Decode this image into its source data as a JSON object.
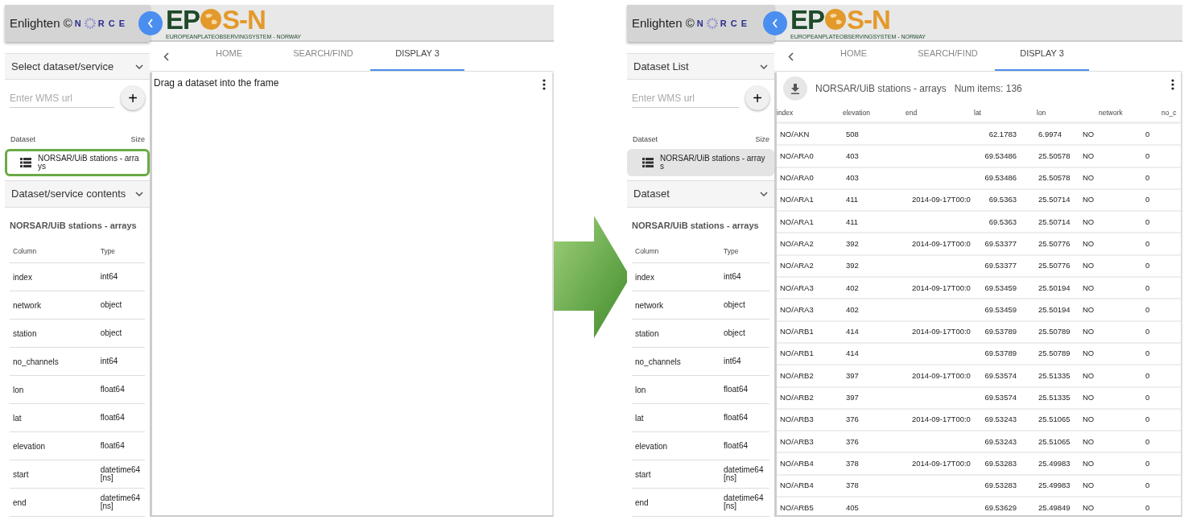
{
  "screens": [
    {
      "app_name": "Enlighten ©",
      "brand_letters": [
        "N",
        "R C E"
      ],
      "logo": {
        "main": [
          "EP",
          "S-N"
        ],
        "subtitle": "EUROPEANPLATEOBSERVINGSYSTEM - NORWAY"
      },
      "source_accordion": {
        "label": "Select dataset/service"
      },
      "url_field": {
        "placeholder": "Enter WMS url",
        "add_label": "+"
      },
      "dataset_list": {
        "columns": [
          "Dataset",
          "Size"
        ],
        "items": [
          {
            "name": "NORSAR/UiB stations - arrays",
            "selected": false,
            "highlighted": true
          }
        ]
      },
      "contents_accordion": {
        "label": "Dataset/service contents"
      },
      "contents_title": "NORSAR/UiB stations - arrays",
      "schema": {
        "columns": [
          "Column",
          "Type"
        ],
        "rows": [
          [
            "index",
            "int64"
          ],
          [
            "network",
            "object"
          ],
          [
            "station",
            "object"
          ],
          [
            "no_channels",
            "int64"
          ],
          [
            "lon",
            "float64"
          ],
          [
            "lat",
            "float64"
          ],
          [
            "elevation",
            "float64"
          ],
          [
            "start",
            "datetime64[ns]"
          ],
          [
            "end",
            "datetime64[ns]"
          ]
        ]
      },
      "tabs": [
        {
          "label": "HOME",
          "selected": false
        },
        {
          "label": "SEARCH/FIND",
          "selected": false
        },
        {
          "label": "DISPLAY 3",
          "selected": true
        }
      ],
      "display": {
        "kind": "empty",
        "message": "Drag a dataset into the frame"
      }
    },
    {
      "app_name": "Enlighten ©",
      "brand_letters": [
        "N",
        "R C E"
      ],
      "logo": {
        "main": [
          "EP",
          "S-N"
        ],
        "subtitle": "EUROPEANPLATEOBSERVINGSYSTEM - NORWAY"
      },
      "source_accordion": {
        "label": "Dataset List"
      },
      "url_field": {
        "placeholder": "Enter WMS url",
        "add_label": "+"
      },
      "dataset_list": {
        "columns": [
          "Dataset",
          "Size"
        ],
        "items": [
          {
            "name": "NORSAR/UiB stations - arrays",
            "selected": true,
            "highlighted": false
          }
        ]
      },
      "contents_accordion": {
        "label": "Dataset"
      },
      "contents_title": "NORSAR/UiB stations - arrays",
      "schema": {
        "columns": [
          "Column",
          "Type"
        ],
        "rows": [
          [
            "index",
            "int64"
          ],
          [
            "network",
            "object"
          ],
          [
            "station",
            "object"
          ],
          [
            "no_channels",
            "int64"
          ],
          [
            "lon",
            "float64"
          ],
          [
            "lat",
            "float64"
          ],
          [
            "elevation",
            "float64"
          ],
          [
            "start",
            "datetime64[ns]"
          ],
          [
            "end",
            "datetime64[ns]"
          ]
        ]
      },
      "tabs": [
        {
          "label": "HOME",
          "selected": false
        },
        {
          "label": "SEARCH/FIND",
          "selected": false
        },
        {
          "label": "DISPLAY 3",
          "selected": true
        }
      ],
      "display": {
        "kind": "table",
        "title": "NORSAR/UiB stations - arrays",
        "count": "Num items: 136",
        "columns": [
          "index",
          "elevation",
          "end",
          "lat",
          "lon",
          "network",
          "no_c"
        ],
        "rows": [
          [
            "NO/AKN",
            "508",
            "",
            "62.1783",
            "6.9974",
            "NO",
            "0"
          ],
          [
            "NO/ARA0",
            "403",
            "",
            "69.53486",
            "25.50578",
            "NO",
            "0"
          ],
          [
            "NO/ARA0",
            "403",
            "",
            "69.53486",
            "25.50578",
            "NO",
            "0"
          ],
          [
            "NO/ARA1",
            "411",
            "2014-09-17T00:0",
            "69.5363",
            "25.50714",
            "NO",
            "0"
          ],
          [
            "NO/ARA1",
            "411",
            "",
            "69.5363",
            "25.50714",
            "NO",
            "0"
          ],
          [
            "NO/ARA2",
            "392",
            "2014-09-17T00:0",
            "69.53377",
            "25.50776",
            "NO",
            "0"
          ],
          [
            "NO/ARA2",
            "392",
            "",
            "69.53377",
            "25.50776",
            "NO",
            "0"
          ],
          [
            "NO/ARA3",
            "402",
            "2014-09-17T00:0",
            "69.53459",
            "25.50194",
            "NO",
            "0"
          ],
          [
            "NO/ARA3",
            "402",
            "",
            "69.53459",
            "25.50194",
            "NO",
            "0"
          ],
          [
            "NO/ARB1",
            "414",
            "2014-09-17T00:0",
            "69.53789",
            "25.50789",
            "NO",
            "0"
          ],
          [
            "NO/ARB1",
            "414",
            "",
            "69.53789",
            "25.50789",
            "NO",
            "0"
          ],
          [
            "NO/ARB2",
            "397",
            "2014-09-17T00:0",
            "69.53574",
            "25.51335",
            "NO",
            "0"
          ],
          [
            "NO/ARB2",
            "397",
            "",
            "69.53574",
            "25.51335",
            "NO",
            "0"
          ],
          [
            "NO/ARB3",
            "376",
            "2014-09-17T00:0",
            "69.53243",
            "25.51065",
            "NO",
            "0"
          ],
          [
            "NO/ARB3",
            "376",
            "",
            "69.53243",
            "25.51065",
            "NO",
            "0"
          ],
          [
            "NO/ARB4",
            "378",
            "2014-09-17T00:0",
            "69.53283",
            "25.49983",
            "NO",
            "0"
          ],
          [
            "NO/ARB4",
            "378",
            "",
            "69.53283",
            "25.49983",
            "NO",
            "0"
          ],
          [
            "NO/ARB5",
            "405",
            "",
            "69.53629",
            "25.49849",
            "NO",
            "0"
          ]
        ]
      }
    }
  ]
}
